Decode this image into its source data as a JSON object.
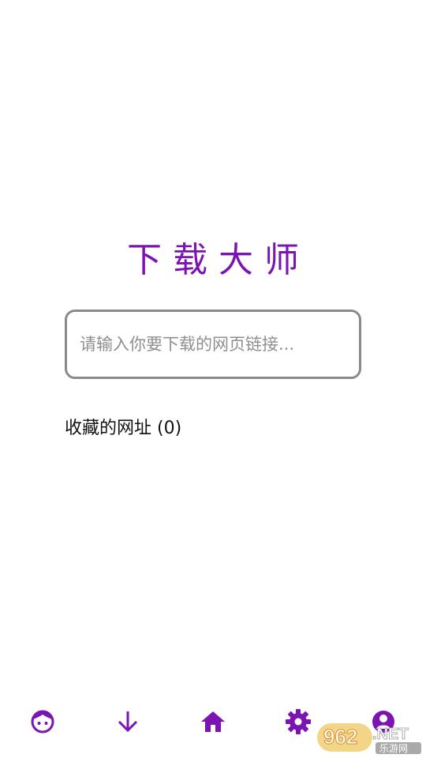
{
  "app": {
    "title": "下载大师"
  },
  "search": {
    "placeholder": "请输入你要下载的网页链接...",
    "value": ""
  },
  "favorites": {
    "label": "收藏的网址 (0)"
  },
  "bottom_nav": {
    "items": [
      {
        "icon": "face-icon"
      },
      {
        "icon": "arrow-down-icon"
      },
      {
        "icon": "home-icon"
      },
      {
        "icon": "gear-icon"
      },
      {
        "icon": "account-icon"
      }
    ]
  },
  "watermark": {
    "brand": "962.NET",
    "subtitle": "乐游网"
  },
  "colors": {
    "accent": "#7b14b2",
    "border": "#8a8a8a",
    "placeholder": "#8f8f8f"
  }
}
